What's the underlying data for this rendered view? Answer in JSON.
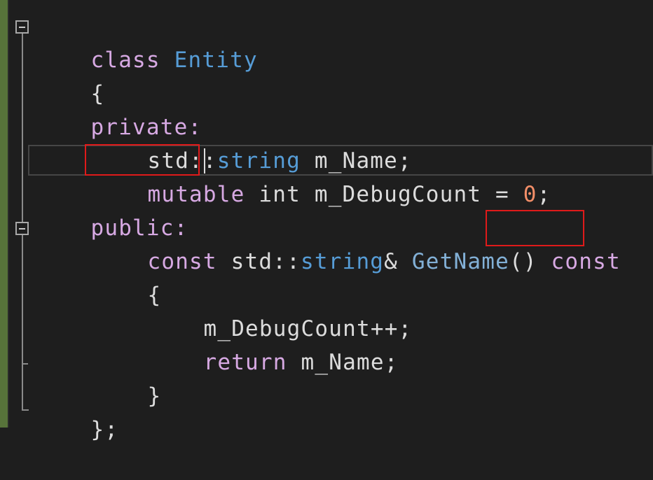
{
  "editor": {
    "lines": [
      {
        "t1": "class",
        "t2": " ",
        "t3": "Entity"
      },
      {
        "t1": "{"
      },
      {
        "t1": "private:"
      },
      {
        "t1": "std::",
        "t2": "string",
        "t3": " m_Name;"
      },
      {
        "t1": "mutable",
        "t2": " int m_DebugCount = ",
        "t3": "0",
        "t4": ";"
      },
      {
        "t1": "public:"
      },
      {
        "t1": "const",
        "t2": " std::",
        "t3": "string",
        "t4": "& ",
        "t5": "GetName",
        "t6": "() ",
        "t7": "const"
      },
      {
        "t1": "{"
      },
      {
        "t1": "m_DebugCount++;"
      },
      {
        "t1": "return",
        "t2": " m_Name;"
      },
      {
        "t1": "}"
      },
      {
        "t1": "};"
      }
    ]
  },
  "colors": {
    "background": "#1e1e1e",
    "text": "#dcdcdc",
    "keyword": "#d7a9e3",
    "type": "#569cd6",
    "function": "#82b0d6",
    "number": "#f28e68",
    "highlight_box": "#e01a1a",
    "change_margin": "#57733a"
  },
  "icons": [
    "collapse-class-icon",
    "collapse-method-icon"
  ]
}
